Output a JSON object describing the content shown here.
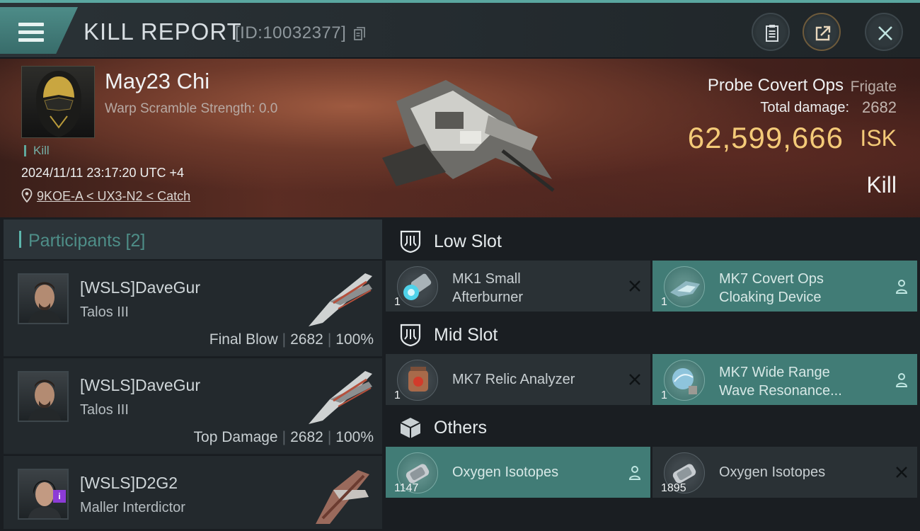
{
  "header": {
    "title": "KILL REPORT",
    "report_id": "[ID:10032377]"
  },
  "victim": {
    "name": "May23 Chi",
    "warp_scramble": "Warp Scramble Strength: 0.0",
    "tag": "Kill",
    "datetime": "2024/11/11 23:17:20 UTC +4",
    "location": "9KOE-A < UX3-N2 < Catch",
    "ship_name": "Probe Covert Ops",
    "ship_class": "Frigate",
    "total_damage_label": "Total damage:",
    "total_damage": "2682",
    "isk_value": "62,599,666",
    "isk_unit": "ISK",
    "result": "Kill"
  },
  "participants": {
    "label": "Participants [2]",
    "items": [
      {
        "name": "[WSLS]DaveGur",
        "ship": "Talos III",
        "role": "Final Blow",
        "damage": "2682",
        "percent": "100%"
      },
      {
        "name": "[WSLS]DaveGur",
        "ship": "Talos III",
        "role": "Top Damage",
        "damage": "2682",
        "percent": "100%"
      },
      {
        "name": "[WSLS]D2G2",
        "ship": "Maller Interdictor",
        "badge": "i"
      }
    ]
  },
  "slots": {
    "low": {
      "label": "Low Slot",
      "items": [
        {
          "name": "MK1 Small Afterburner",
          "line1": "MK1 Small",
          "line2": "Afterburner",
          "qty": "1",
          "state": "destroyed"
        },
        {
          "name": "MK7 Covert Ops Cloaking Device",
          "line1": "MK7 Covert Ops",
          "line2": "Cloaking Device",
          "qty": "1",
          "state": "dropped"
        }
      ]
    },
    "mid": {
      "label": "Mid Slot",
      "items": [
        {
          "name": "MK7 Relic Analyzer",
          "qty": "1",
          "state": "destroyed"
        },
        {
          "name": "MK7 Wide Range Wave Resonance...",
          "line1": "MK7 Wide Range",
          "line2": "Wave Resonance...",
          "qty": "1",
          "state": "dropped"
        }
      ]
    },
    "others": {
      "label": "Others",
      "items": [
        {
          "name": "Oxygen Isotopes",
          "qty": "1147",
          "state": "dropped"
        },
        {
          "name": "Oxygen Isotopes",
          "qty": "1895",
          "state": "destroyed"
        }
      ]
    }
  },
  "colors": {
    "accent": "#4e8e88",
    "dropped_bg": "#417c76",
    "isk_gold": "#f4ca78"
  }
}
